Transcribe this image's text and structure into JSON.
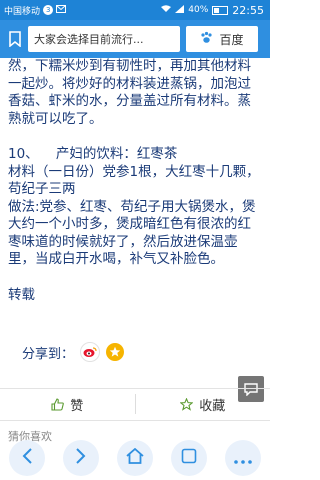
{
  "status_bar": {
    "carrier": "中国移动",
    "notification_count": "3",
    "battery": "40%",
    "battery_level": 0.4,
    "time": "22:55"
  },
  "toolbar": {
    "url_title": "大家会选择目前流行...",
    "search_label": "百度"
  },
  "article": {
    "paragraphs": [
      "然，下糯米炒到有韧性时，再加其他材料一起炒。将炒好的材料装进蒸锅，加泡过香菇、虾米的水，分量盖过所有材料。蒸熟就可以吃了。",
      "10、    产妇的饮料：红枣茶",
      "材料（一日份）党参1根，大红枣十几颗，苟纪子三两",
      "做法:党参、红枣、苟纪子用大锅煲水，煲大约一个小时多，煲成暗红色有很浓的红枣味道的时候就好了，然后放进保温壶里，当成白开水喝，补气又补脸色。"
    ],
    "repost": "转载"
  },
  "share": {
    "label": "分享到："
  },
  "actions": {
    "like": "赞",
    "favorite": "收藏"
  },
  "partial_text": "猜你喜欢",
  "colors": {
    "status_bar": "#1e83d6",
    "toolbar": "#2f8fe0",
    "text": "#1b3b78"
  }
}
